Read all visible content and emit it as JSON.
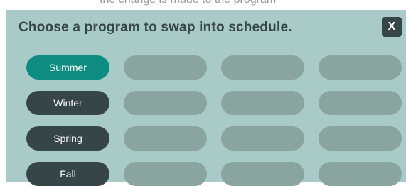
{
  "header": {
    "top_text": "the change is made to the program",
    "title": "Choose a program to swap into schedule.",
    "close_label": "X"
  },
  "programs": [
    {
      "label": "Summer",
      "selected": true
    },
    {
      "label": "Winter",
      "selected": false
    },
    {
      "label": "Spring",
      "selected": false
    },
    {
      "label": "Fall",
      "selected": false
    }
  ],
  "colors": {
    "panel_background": "#a9cbc8",
    "program_button": "#364547",
    "selected_program_button": "#0e8c82",
    "empty_slot": "#8aa49f",
    "title_text": "#364547"
  }
}
